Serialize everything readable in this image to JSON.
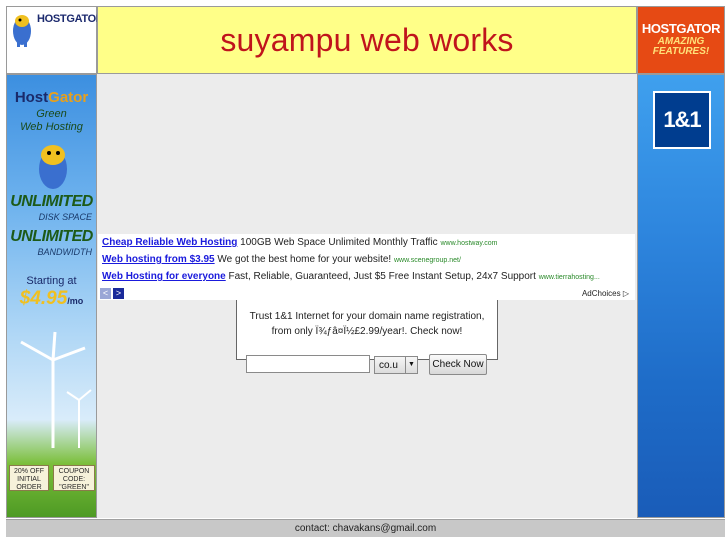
{
  "header": {
    "logo_text": "HOSTGATOR",
    "site_title": "suyampu web works",
    "right_banner": {
      "brand": "HOSTGATOR",
      "tagline": "AMAZING FEATURES!"
    }
  },
  "left_ad": {
    "brand_a": "Host",
    "brand_b": "Gator",
    "line1": "Green",
    "line2": "Web Hosting",
    "unlimited": "UNLIMITED",
    "disk": "DISK SPACE",
    "bandwidth": "BANDWIDTH",
    "starting": "Starting at",
    "price": "$4.95",
    "per": "/mo",
    "coupon_left": "20% OFF INITIAL ORDER",
    "coupon_right": "COUPON CODE: \"GREEN\""
  },
  "right_ad": {
    "logo": "1&1"
  },
  "text_ads": [
    {
      "title": "Cheap Reliable Web Hosting",
      "desc": "100GB Web Space Unlimited Monthly Traffic",
      "url": "www.hostway.com"
    },
    {
      "title": "Web hosting from $3.95",
      "desc": "We got the best home for your website!",
      "url": "www.scenegroup.net/"
    },
    {
      "title": "Web Hosting for everyone",
      "desc": "Fast, Reliable, Guaranteed, Just $5 Free Instant Setup, 24x7 Support",
      "url": "www.tierrahosting..."
    }
  ],
  "ad_nav": {
    "prev": "<",
    "next": ">"
  },
  "adchoices": "AdChoices ▷",
  "domain": {
    "line1": "Trust 1&1 Internet for your domain name registration,",
    "line2": "from only Ï¾ƒâ¤Ï½£2.99/year!. Check now!",
    "input_value": "",
    "tld": "co.u",
    "button": "Check Now"
  },
  "footer": {
    "contact": "contact: chavakans@gmail.com"
  },
  "colors": {
    "title_red": "#c0141c",
    "header_yellow": "#ffff88",
    "link_blue": "#1a1adc",
    "url_green": "#2a8a2a"
  }
}
